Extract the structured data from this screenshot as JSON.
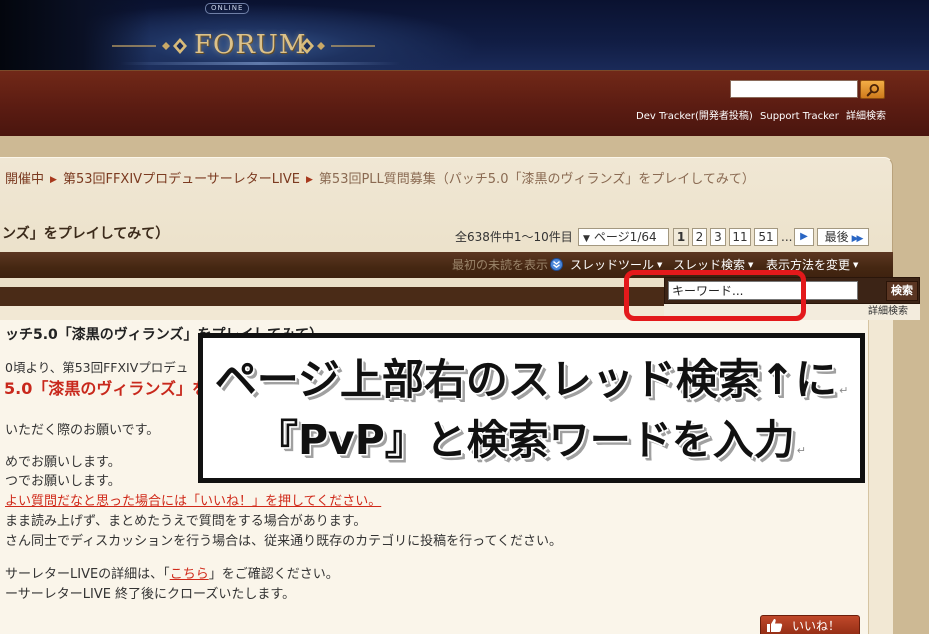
{
  "banner": {
    "online_label": "ONLINE",
    "forum_logo": "FORUM"
  },
  "header": {
    "links": {
      "dev_tracker": "Dev Tracker(開発者投稿)",
      "support_tracker": "Support Tracker",
      "advanced_search": "詳細検索"
    }
  },
  "breadcrumb": {
    "separator": "▶",
    "items": [
      "開催中",
      "第53回FFXIVプロデューサーレターLIVE",
      "第53回PLL質問募集（パッチ5.0「漆黒のヴィランズ」をプレイしてみて）"
    ]
  },
  "thread": {
    "title": "ンズ」をプレイしてみて）",
    "result_count": "全638件中1～10件目",
    "pager": {
      "select_arrow": "▼",
      "page_label": "ページ1/64",
      "pages": [
        "1",
        "2",
        "3",
        "11",
        "51"
      ],
      "ellipsis": "...",
      "next": "▶",
      "last_label": "最後",
      "last_arrow": "▶▶"
    }
  },
  "toolbar": {
    "first_unread": "最初の未読を表示",
    "thread_tools": "スレッドツール",
    "thread_search": "スレッド検索",
    "display_mode": "表示方法を変更",
    "caret": "▼"
  },
  "search_dropdown": {
    "keyword_placeholder": "キーワード...",
    "search_button": "検索",
    "advanced_search": "詳細検索"
  },
  "post": {
    "title": "ッチ5.0「漆黒のヴィランズ」をプレイしてみて）",
    "intro": "0頃より、第53回FFXIVプロデュ",
    "headline": "5.0「漆黒のヴィランズ」を",
    "lines": [
      "いただく際のお願いです。",
      "めでお願いします。",
      "つでお願いします。",
      "よい質問だなと思った場合には「いいね！」を押してください。",
      "まま読み上げず、まとめたうえで質問をする場合があります。",
      "さん同士でディスカッションを行う場合は、従来通り既存のカテゴリに投稿を行ってください。"
    ],
    "details_prefix": "サーレターLIVEの詳細は、「",
    "details_link": "こちら",
    "details_suffix": "」をご確認ください。",
    "closing": "ーサーレターLIVE 終了後にクローズいたします。",
    "like_button": "いいね！"
  },
  "annotation": {
    "line1": "ページ上部右のスレッド検索↑に",
    "line2": "『PvP』と検索ワードを入力",
    "return_mark": "↵"
  },
  "icons": {
    "header_search": "search-icon",
    "first_unread": "double-chevron-down-icon",
    "like": "thumbs-up-icon",
    "ornament": "diamond-ornament-icon"
  },
  "colors": {
    "banner_bg": "#111d44",
    "header_bg": "#5b1c12",
    "toolbar_bg": "#452712",
    "link": "#7b3a20",
    "alert_red": "#c8281c",
    "highlight_red": "#e3191b",
    "pager_arrow": "#2a66c4",
    "search_button": "#e89a35"
  }
}
